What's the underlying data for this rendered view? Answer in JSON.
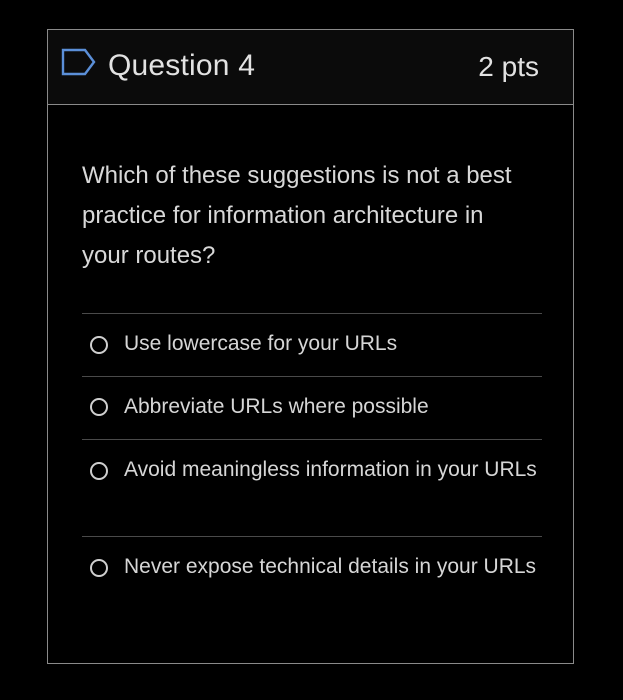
{
  "question": {
    "title": "Question 4",
    "points": "2 pts",
    "prompt": "Which of these suggestions is not a best practice for information architecture in your routes?",
    "options": [
      {
        "label": "Use lowercase for your URLs",
        "selected": false
      },
      {
        "label": "Abbreviate URLs where possible",
        "selected": false
      },
      {
        "label": "Avoid meaningless information in your URLs",
        "selected": false
      },
      {
        "label": "Never expose technical details in your URLs",
        "selected": false
      }
    ]
  },
  "icons": {
    "flag": "bookmark-flag-icon",
    "radio": "radio-button-icon"
  },
  "colors": {
    "background": "#000000",
    "header_bg": "#0b0b0b",
    "border": "#8a8a8a",
    "divider": "#4a4a4a",
    "text": "#d6d6d6",
    "flag_accent": "#5b8fd8"
  }
}
